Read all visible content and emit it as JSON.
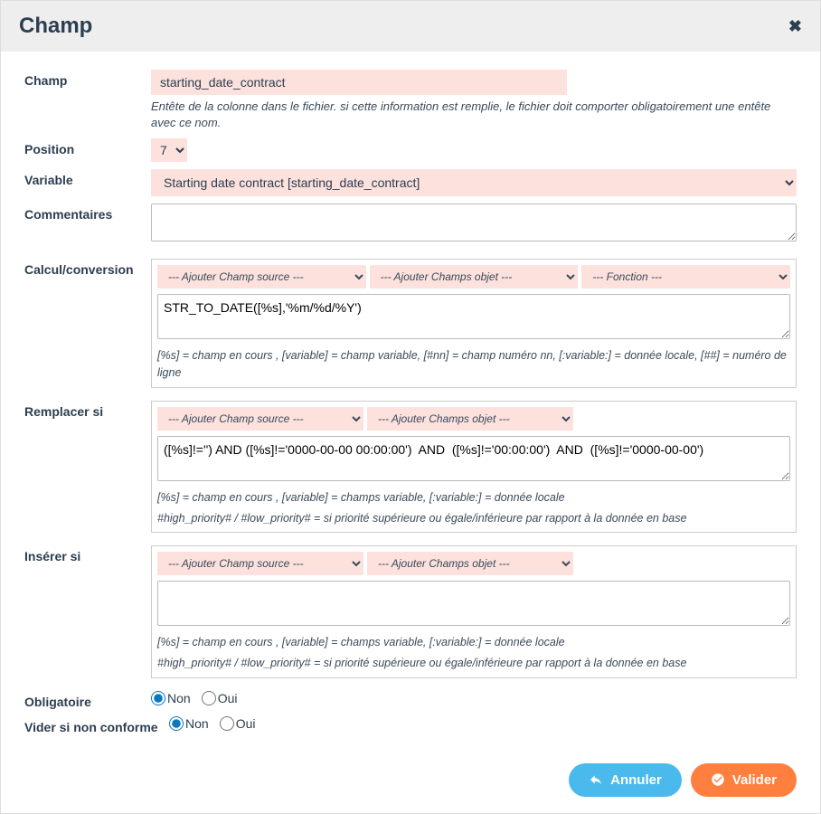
{
  "header": {
    "title": "Champ"
  },
  "labels": {
    "champ": "Champ",
    "position": "Position",
    "variable": "Variable",
    "commentaires": "Commentaires",
    "calcul": "Calcul/conversion",
    "remplacer": "Remplacer si",
    "inserer": "Insérer si",
    "obligatoire": "Obligatoire",
    "vider": "Vider si non conforme"
  },
  "champ": {
    "value": "starting_date_contract",
    "help": "Entête de la colonne dans le fichier. si cette information est remplie, le fichier doit comporter obligatoirement une entête avec ce nom."
  },
  "position": {
    "value": "7"
  },
  "variable": {
    "value": "Starting date contract [starting_date_contract]"
  },
  "commentaires": {
    "value": ""
  },
  "calcul": {
    "select_source": "--- Ajouter Champ source ---",
    "select_objet": "--- Ajouter Champs objet ---",
    "select_fonction": "--- Fonction ---",
    "value": "STR_TO_DATE([%s],'%m/%d/%Y')",
    "hint": "[%s] = champ en cours , [variable] = champ variable, [#nn] = champ numéro nn, [:variable:] = donnée locale, [##] = numéro de ligne"
  },
  "remplacer": {
    "select_source": "--- Ajouter Champ source ---",
    "select_objet": "--- Ajouter Champs objet ---",
    "value": "([%s]!='') AND ([%s]!='0000-00-00 00:00:00')  AND  ([%s]!='00:00:00')  AND  ([%s]!='0000-00-00')",
    "hint1": "[%s] = champ en cours , [variable] = champs variable, [:variable:] = donnée locale",
    "hint2": "#high_priority# / #low_priority# = si priorité supérieure ou égale/inférieure par rapport à la donnée en base"
  },
  "inserer": {
    "select_source": "--- Ajouter Champ source ---",
    "select_objet": "--- Ajouter Champs objet ---",
    "value": "",
    "hint1": "[%s] = champ en cours , [variable] = champs variable, [:variable:] = donnée locale",
    "hint2": "#high_priority# / #low_priority# = si priorité supérieure ou égale/inférieure par rapport à la donnée en base"
  },
  "radio": {
    "non": "Non",
    "oui": "Oui"
  },
  "buttons": {
    "cancel": "Annuler",
    "validate": "Valider"
  }
}
